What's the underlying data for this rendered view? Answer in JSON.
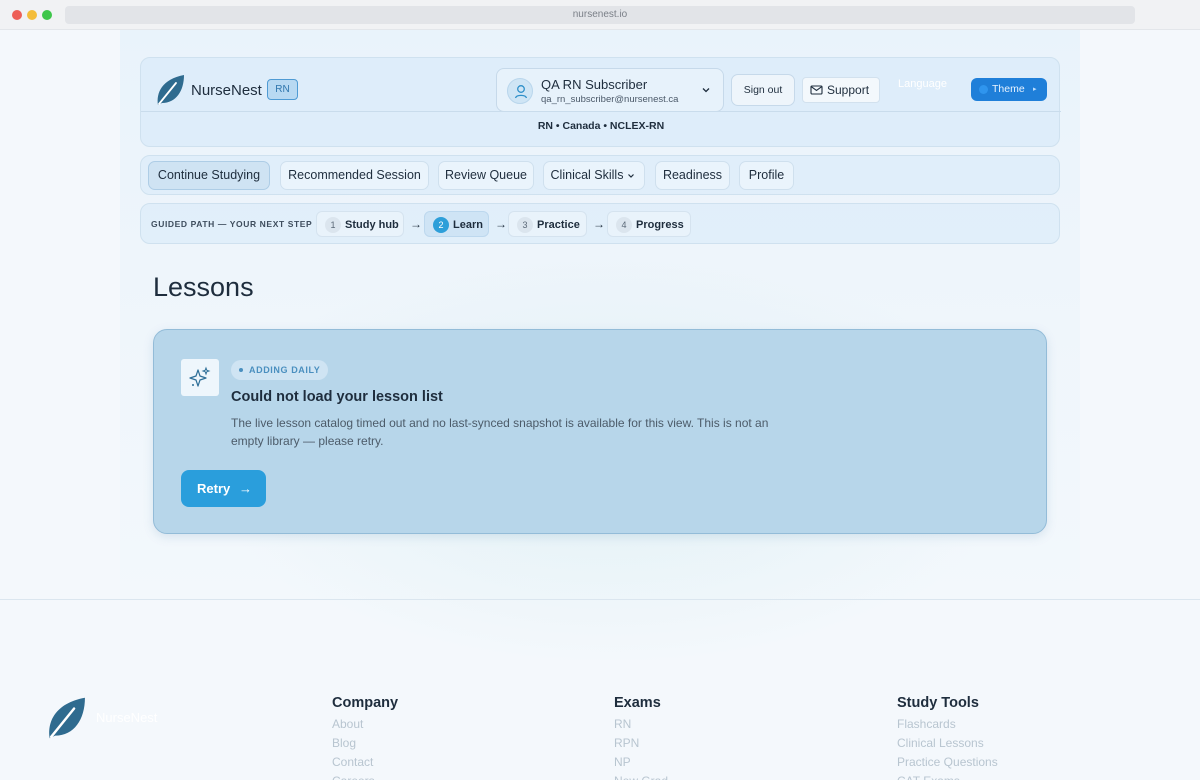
{
  "browser": {
    "url": "nursenest.io"
  },
  "header": {
    "brand": "NurseNest",
    "role_badge": "RN",
    "user_name": "QA RN Subscriber",
    "user_email": "qa_rn_subscriber@nursenest.ca",
    "sign_out": "Sign out",
    "support": "Support",
    "language": "Language",
    "theme": "Theme",
    "context": "RN • Canada • NCLEX-RN"
  },
  "nav": {
    "items": [
      {
        "label": "Continue Studying",
        "active": true
      },
      {
        "label": "Recommended Session"
      },
      {
        "label": "Review Queue"
      },
      {
        "label": "Clinical Skills"
      },
      {
        "label": "Readiness"
      },
      {
        "label": "Profile"
      }
    ]
  },
  "guided_path": {
    "label": "GUIDED PATH — YOUR NEXT STEP",
    "steps": [
      {
        "num": "1",
        "label": "Study hub"
      },
      {
        "num": "2",
        "label": "Learn",
        "active": true
      },
      {
        "num": "3",
        "label": "Practice"
      },
      {
        "num": "4",
        "label": "Progress"
      }
    ],
    "arrow": "→"
  },
  "main": {
    "title": "Lessons",
    "error": {
      "badge": "ADDING DAILY",
      "title": "Could not load your lesson list",
      "body": "The live lesson catalog timed out and no last-synced snapshot is available for this view. This is not an empty library — please retry.",
      "retry": "Retry",
      "retry_arrow": "→"
    }
  },
  "footer": {
    "brand": "NurseNest",
    "columns": [
      {
        "heading": "Company",
        "links": [
          "About",
          "Blog",
          "Contact",
          "Careers"
        ]
      },
      {
        "heading": "Exams",
        "links": [
          "RN",
          "RPN",
          "NP",
          "New Grad"
        ]
      },
      {
        "heading": "Study Tools",
        "links": [
          "Flashcards",
          "Clinical Lessons",
          "Practice Questions",
          "CAT Exams"
        ]
      }
    ]
  },
  "colors": {
    "accent": "#2a9edc",
    "theme_button": "#1f7fd9",
    "card_error_bg": "#b7d6ea"
  }
}
